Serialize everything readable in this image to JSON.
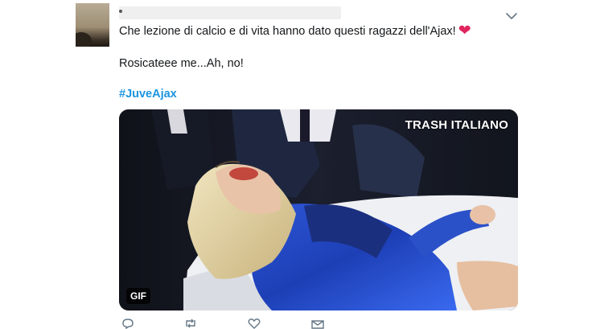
{
  "tweet": {
    "text_line1": "Che lezione di calcio e di vita hanno dato questi ragazzi dell'Ajax!",
    "emoji": "❤",
    "text_line2": "Rosicateee me...Ah, no!",
    "hashtag": "#JuveAjax",
    "media": {
      "watermark": "TRASH ITALIANO",
      "badge": "GIF"
    },
    "icons": {
      "menu": "chevron-down-icon",
      "reply": "reply-icon",
      "retweet": "retweet-icon",
      "like": "heart-icon",
      "share": "share-icon"
    }
  },
  "colors": {
    "hashtag": "#1b95e0",
    "heart": "#e0245e",
    "text": "#14171a",
    "icon": "#657786"
  }
}
